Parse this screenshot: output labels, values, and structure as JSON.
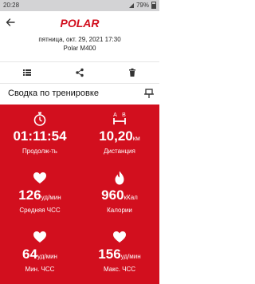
{
  "status_bar": {
    "time": "20:28",
    "battery": "79%"
  },
  "app": {
    "brand": "POLAR"
  },
  "session": {
    "date": "пятница, окт. 29, 2021 17:30",
    "device": "Polar M400"
  },
  "section": {
    "title": "Сводка по тренировке"
  },
  "stats": [
    {
      "icon": "stopwatch-icon",
      "value": "01:11:54",
      "unit": "",
      "label": "Продолж-ть"
    },
    {
      "icon": "distance-icon",
      "value": "10,20",
      "unit": "км",
      "label": "Дистанция"
    },
    {
      "icon": "heart-icon",
      "value": "126",
      "unit": "уд/мин",
      "label": "Средняя ЧСС"
    },
    {
      "icon": "flame-icon",
      "value": "960",
      "unit": "кКал",
      "label": "Калории"
    },
    {
      "icon": "heart-icon",
      "value": "64",
      "unit": "уд/мин",
      "label": "Мин. ЧСС"
    },
    {
      "icon": "heart-icon",
      "value": "156",
      "unit": "уд/мин",
      "label": "Макс. ЧСС"
    }
  ],
  "colors": {
    "accent": "#d20f1e",
    "status_bar": "#d3d3d5"
  }
}
